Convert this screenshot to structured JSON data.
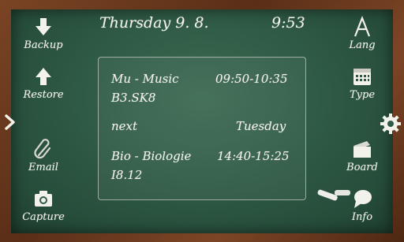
{
  "header": {
    "date": "Thursday 9. 8.",
    "time": "9:53"
  },
  "left_menu": [
    {
      "label": "Backup",
      "icon": "download-arrow-icon"
    },
    {
      "label": "Restore",
      "icon": "upload-arrow-icon"
    },
    {
      "label": "Email",
      "icon": "paperclip-icon"
    },
    {
      "label": "Capture",
      "icon": "camera-icon"
    }
  ],
  "right_menu": [
    {
      "label": "Lang",
      "icon": "letter-a-icon"
    },
    {
      "label": "Type",
      "icon": "calendar-icon"
    },
    {
      "label": "Board",
      "icon": "folder-icon"
    },
    {
      "label": "Info",
      "icon": "speech-bubble-icon"
    }
  ],
  "schedule": {
    "current": {
      "subject": "Mu - Music",
      "time": "09:50-10:35",
      "room": "B3.SK8"
    },
    "next_label": "next",
    "next_day": "Tuesday",
    "next": {
      "subject": "Bio - Biologie",
      "time": "14:40-15:25",
      "room": "I8.12"
    }
  },
  "colors": {
    "board": "#2f5a45",
    "chalk": "#f2f2ea",
    "frame": "#6b3a1d"
  }
}
